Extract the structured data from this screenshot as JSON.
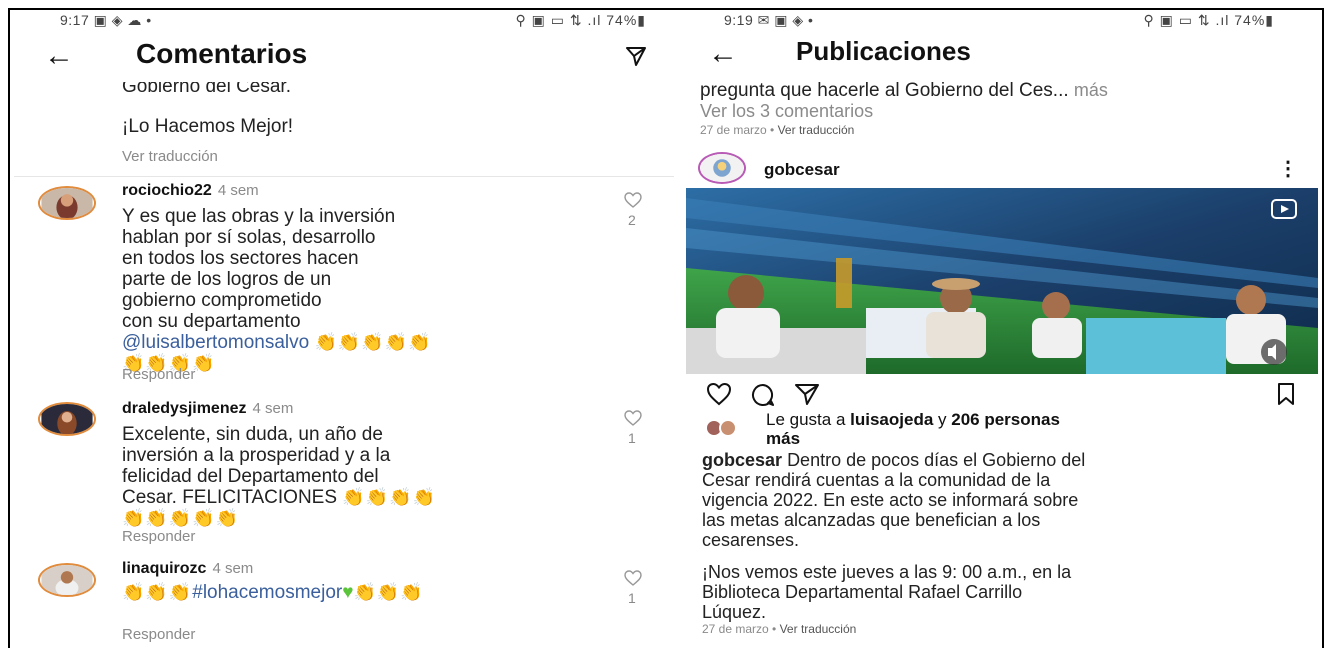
{
  "left": {
    "status": {
      "time": "9:17",
      "icons": "▣ ◈ ☁ •",
      "right": "⚲ ▣ ▭ ⇅ .ıl 74%▮"
    },
    "title": "Comentarios",
    "caption_tail_1": "Gobierno del Cesar.",
    "caption_tail_2": "¡Lo Hacemos Mejor!",
    "see_translation": "Ver traducción",
    "comments": [
      {
        "user": "rociochio22",
        "time": "4 sem",
        "text_lines": [
          "Y es que las obras y la inversión",
          "hablan por sí solas, desarrollo",
          "en todos los sectores hacen",
          "parte de los logros de un",
          "gobierno comprometido",
          "con su departamento"
        ],
        "mention": "@luisalbertomonsalvo",
        "likes": "2",
        "reply": "Responder"
      },
      {
        "user": "draledysjimenez",
        "time": "4 sem",
        "text_lines": [
          "Excelente, sin duda, un año de",
          "inversión a la prosperidad y a la",
          "felicidad del Departamento del",
          "Cesar. FELICITACIONES"
        ],
        "likes": "1",
        "reply": "Responder"
      },
      {
        "user": "linaquirozc",
        "time": "4 sem",
        "hashtag": "#lohacemosmejor",
        "likes": "1",
        "reply": "Responder"
      }
    ]
  },
  "right": {
    "status": {
      "time": "9:19",
      "icons": "✉ ▣ ◈ •",
      "right": "⚲ ▣ ▭ ⇅ .ıl 74%▮"
    },
    "title": "Publicaciones",
    "prev_caption": "pregunta que hacerle al Gobierno del Ces...",
    "more": "más",
    "view_comments": "Ver los 3 comentarios",
    "prev_date": "27 de marzo",
    "see_translation": "Ver traducción",
    "username": "gobcesar",
    "likes_prefix": "Le gusta a",
    "likes_user": "luisaojeda",
    "likes_join": "y",
    "likes_rest_1": "206 personas",
    "likes_rest_2": "más",
    "caption_user": "gobcesar",
    "caption_lines": [
      "Dentro de pocos días el Gobierno del",
      "Cesar rendirá cuentas a la comunidad de la",
      "vigencia 2022. En este acto se informará sobre",
      "las metas alcanzadas que benefician a los",
      "cesarenses."
    ],
    "caption2_lines": [
      "¡Nos vemos este jueves a las 9: 00 a.m., en la",
      "Biblioteca Departamental Rafael Carrillo",
      "Lúquez."
    ],
    "date": "27 de marzo",
    "dot": "•"
  },
  "colors": {
    "accent": "#3a5f9c",
    "muted": "#8a8a8a",
    "avatar_ring": "#e18b3c"
  }
}
